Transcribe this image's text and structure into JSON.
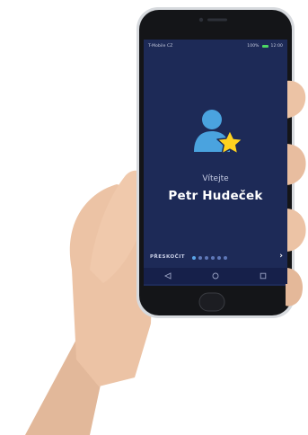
{
  "statusbar": {
    "left": "T-Mobile CZ",
    "right": "100%",
    "time": "12:00"
  },
  "welcome": {
    "title": "Vítejte",
    "user_name": "Petr Hudeček"
  },
  "onboarding": {
    "skip_label": "PŘESKOČIT",
    "next_label": "›",
    "pages": 6,
    "active_page": 1
  },
  "navbar": {
    "items": [
      "back-icon",
      "home-icon",
      "recents-icon"
    ]
  },
  "colors": {
    "screen_bg": "#1d2a57",
    "person_icon": "#4aa3df",
    "star_icon": "#ffd21f",
    "active_dot": "#5aa5e8"
  }
}
